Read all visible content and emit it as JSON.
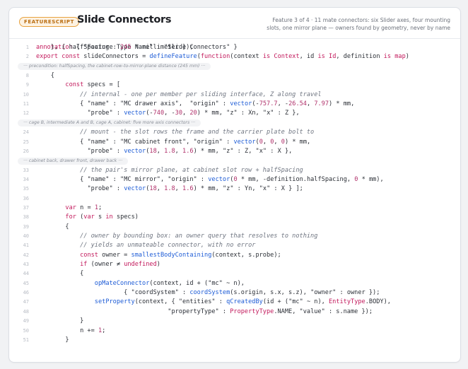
{
  "header": {
    "badge": "FEATURESCRIPT",
    "title": "Slide Connectors",
    "subtitle_line1": "Feature 3 of 4 · 11 mate connectors: six Slider axes, four mounting",
    "subtitle_line2": "slots, one mirror plane — owners found by geometry, never by name"
  },
  "folds": [
    "··· precondition: halfSpacing, the cabinet-row-to-mirror-plane distance (245 mm) ···",
    "··· cage B, intermediate A and B, cage A, cabinet: five more axis connectors ···",
    "··· cabinet back, drawer front, drawer back ···"
  ],
  "line_numbers": [
    "1",
    "2",
    "8",
    "9",
    "10",
    "11",
    "12",
    "24",
    "25",
    "26",
    "33",
    "34",
    "35",
    "36",
    "37",
    "38",
    "39",
    "40",
    "41",
    "42",
    "43",
    "44",
    "45",
    "46",
    "47",
    "48",
    "49",
    "50",
    "51"
  ],
  "code_lines": [
    "annotation { \"Feature Type Name\" : \"Slide Connectors\" }",
    "export const slideConnectors = defineFeature(function(context is Context, id is Id, definition is map)",
    "    {",
    "        const specs = [",
    "            // internal - one per member per sliding interface, Z along travel",
    "            { \"name\" : \"MC drawer axis\",  \"origin\" : vector(-757.7, -26.54, 7.97) * mm,",
    "              \"probe\" : vector(-740, -30, 20) * mm, \"z\" : Xn, \"x\" : Z },",
    "            // mount - the slot rows the frame and the carrier plate bolt to",
    "            { \"name\" : \"MC cabinet front\", \"origin\" : vector(0, 0, 0) * mm,",
    "              \"probe\" : vector(18, 1.8, 1.6) * mm, \"z\" : Z, \"x\" : X },",
    "            // the pair's mirror plane, at cabinet slot row + halfSpacing",
    "            { \"name\" : \"MC mirror\", \"origin\" : vector(0 * mm, -definition.halfSpacing, 0 * mm),",
    "              \"probe\" : vector(18, 1.8, 1.6) * mm, \"z\" : Yn, \"x\" : X } ];",
    "",
    "        var n = 1;",
    "        for (var s in specs)",
    "        {",
    "            // owner by bounding box: an owner query that resolves to nothing",
    "            // yields an unmateable connector, with no error",
    "            const owner = smallestBodyContaining(context, s.probe);",
    "            if (owner ≠ undefined)",
    "            {",
    "                opMateConnector(context, id + (\"mc\" ~ n),",
    "                        { \"coordSystem\" : coordSystem(s.origin, s.x, s.z), \"owner\" : owner });",
    "                setProperty(context, { \"entities\" : qCreatedBy(id + (\"mc\" ~ n), EntityType.BODY),",
    "                                    \"propertyType\" : PropertyType.NAME, \"value\" : s.name });",
    "            }",
    "            n += 1;",
    "        }",
    "    }, { halfSpacing : 245 * millimeter });"
  ]
}
